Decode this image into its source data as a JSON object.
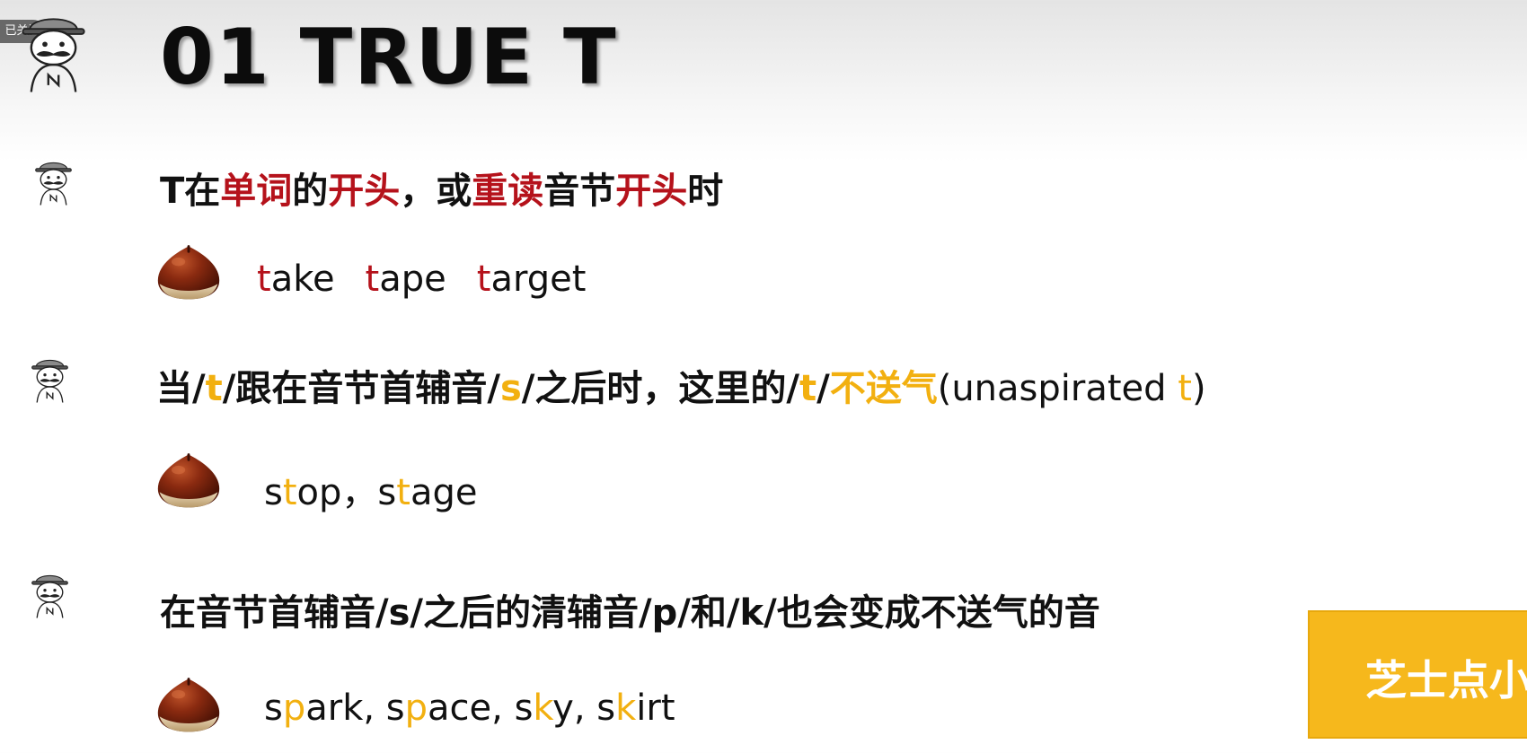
{
  "follow_badge": "已关注",
  "title": "01 TRUE T",
  "rules": [
    {
      "text": {
        "p1": "T在",
        "p2": "单词",
        "p3": "的",
        "p4": "开头",
        "p5": "，或",
        "p6": "重读",
        "p7": "音节",
        "p8": "开头",
        "p9": "时"
      }
    },
    {
      "text": {
        "p1": "当/",
        "p2": "t",
        "p3": "/跟在音节首辅音/",
        "p4": "s",
        "p5": "/之后时，这里的/",
        "p6": "t",
        "p7": "/",
        "p8": "不送气",
        "p9": "(unaspirated",
        "p10": "t",
        "p11": ")"
      }
    },
    {
      "text": "在音节首辅音/s/之后的清辅音/p/和/k/也会变成不送气的音"
    }
  ],
  "examples": [
    {
      "words": [
        {
          "hl": "t",
          "rest": "ake"
        },
        {
          "hl": "t",
          "rest": "ape"
        },
        {
          "hl": "t",
          "rest": "arget"
        }
      ]
    },
    {
      "parts": {
        "w1a": "s",
        "w1b": "t",
        "w1c": "op，",
        "w2a": "s",
        "w2b": "t",
        "w2c": "age"
      }
    },
    {
      "parts": {
        "w1a": "s",
        "w1b": "p",
        "w1c": "ark, ",
        "w2a": "s",
        "w2b": "p",
        "w2c": "ace, ",
        "w3a": "s",
        "w3b": "k",
        "w3c": "y, ",
        "w4a": "s",
        "w4b": "k",
        "w4c": "irt"
      }
    }
  ],
  "watermark": "芝士点小",
  "colors": {
    "red": "#b5121b",
    "yellow": "#f2b010",
    "watermark_bg": "#f6b81c"
  },
  "icons": {
    "mascot": "mustache-man-icon",
    "bullet": "chestnut-icon"
  }
}
